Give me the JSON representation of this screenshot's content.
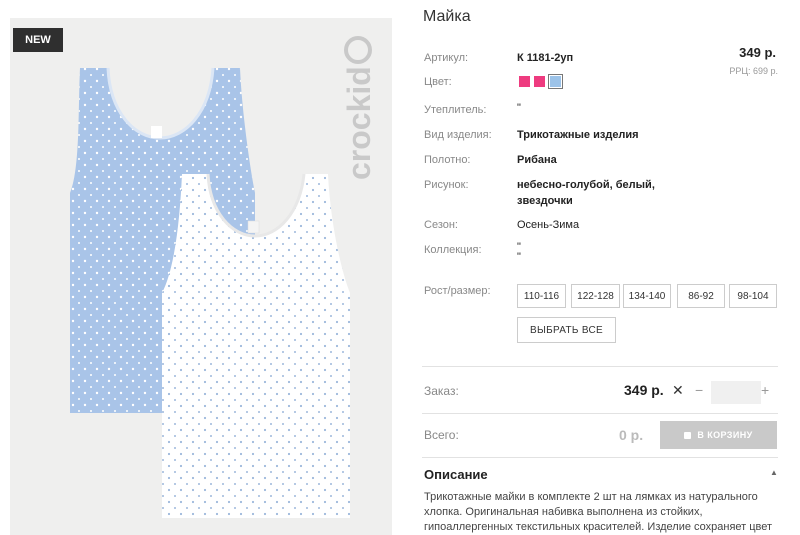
{
  "badge": "NEW",
  "brand": "crockid",
  "product": {
    "title": "Майка",
    "price": "349 р.",
    "rrp": "РРЦ: 699 р."
  },
  "details": {
    "article_label": "Артикул:",
    "article_value": "К 1181-2уп",
    "color_label": "Цвет:",
    "colors": [
      "#ee3b7f",
      "#ee3b7f",
      "#9cc3e9"
    ],
    "insulation_label": "Утеплитель:",
    "insulation_value": "\"",
    "type_label": "Вид изделия:",
    "type_value": "Трикотажные изделия",
    "fabric_label": "Полотно:",
    "fabric_value": "Рибана",
    "pattern_label": "Рисунок:",
    "pattern_line1": "небесно-голубой, белый,",
    "pattern_line2": "звездочки",
    "season_label": "Сезон:",
    "season_value": "Осень-Зима",
    "collection_label": "Коллекция:",
    "collection_line1": "\"",
    "collection_line2": "\"",
    "size_label": "Рост/размер:",
    "sizes": [
      "110-116",
      "122-128",
      "134-140",
      "86-92",
      "98-104"
    ],
    "select_all": "ВЫБРАТЬ ВСЕ"
  },
  "order": {
    "label": "Заказ:",
    "price": "349 р.",
    "remove": "✕",
    "minus": "−",
    "plus": "+",
    "quantity": ""
  },
  "total": {
    "label": "Всего:",
    "value": "0 р.",
    "cart_button": "В КОРЗИНУ"
  },
  "description": {
    "title": "Описание",
    "caret": "▲",
    "text": "Трикотажные майки в комплекте 2 шт на лямках из натурального хлопка. Оригинальная набивка выполнена из стойких, гипоаллергенных текстильных красителей. Изделие сохраняет цвет"
  }
}
